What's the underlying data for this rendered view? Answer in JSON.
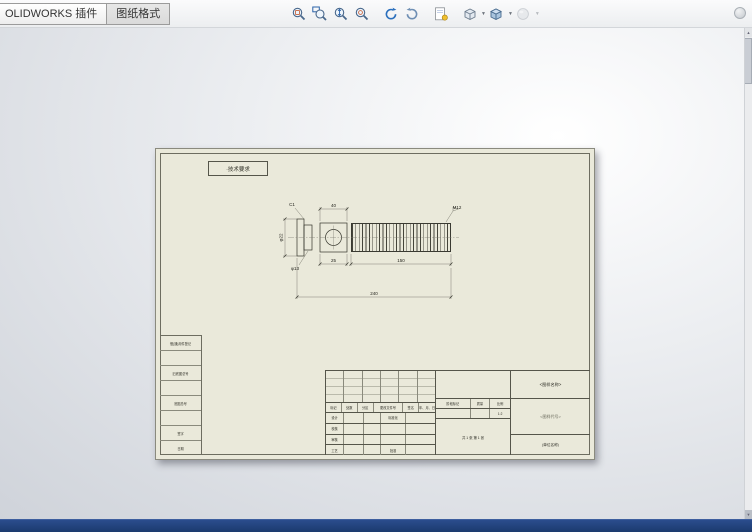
{
  "tabs": [
    {
      "label": "OLIDWORKS 插件"
    },
    {
      "label": "图纸格式"
    }
  ],
  "toolbar": {
    "icons": [
      "zoom-to-fit",
      "zoom-to-area",
      "zoom-in-out",
      "magnified-view",
      "rotate-view",
      "roll-view",
      "3d-drawing-view",
      "view-orientation",
      "display-style",
      "apply-scene"
    ]
  },
  "sheet": {
    "note": "·技术要求",
    "drawing": {
      "dim_head_len": "40",
      "chamfer": "C1",
      "thread_callout": "M12",
      "dim_head_dia": "φ22",
      "dim_flange_dia": "φ13",
      "dim_neck": "25",
      "dim_thread_len": "150",
      "dim_overall": "240"
    },
    "left_table": {
      "rows": [
        "借(通)用件登记",
        "",
        "旧底图总号",
        "",
        "底图总号",
        "",
        "签字",
        "日期"
      ]
    },
    "title_block": {
      "header_row": [
        "标记",
        "处数",
        "分区",
        "更改文件号",
        "签名",
        "年、月、日"
      ],
      "sig_rows": [
        {
          "c1": "设计",
          "c4": "标准化"
        },
        {
          "c1": "校核",
          "c4": ""
        },
        {
          "c1": "审核",
          "c4": ""
        },
        {
          "c1": "工艺",
          "c4": "批准"
        }
      ],
      "stage_label": "阶段标记",
      "mass_label": "质量",
      "scale_label": "比例",
      "scale_value": "1:2",
      "sheet_info": "共 1 张  第 1 张",
      "name_cell": "<图样名称>",
      "code_cell": "<图样代号>",
      "firm_cell": "(单位名称)"
    }
  },
  "colors": {
    "accent_blue": "#2a6fbd",
    "sheet_bg": "#eae9da",
    "statusbar_bg": "#1b3a6e"
  }
}
